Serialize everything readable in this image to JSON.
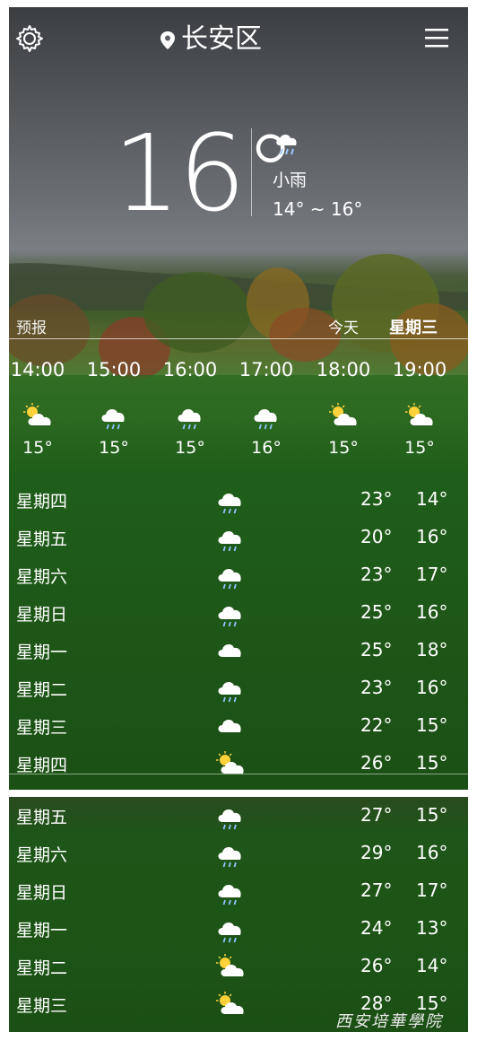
{
  "header": {
    "location": "长安区",
    "icons": [
      "settings-gear-icon",
      "location-pin-icon",
      "menu-hamburger-icon"
    ]
  },
  "current": {
    "temperature": "16°",
    "condition": "小雨",
    "range": "14° ~ 16°",
    "icon": "light-rain-icon"
  },
  "forecast": {
    "label": "预报",
    "today_label": "今天",
    "weekday_label": "星期三"
  },
  "hourly": [
    {
      "time": "14:00",
      "icon": "partly-sunny-icon",
      "temp": "15°"
    },
    {
      "time": "15:00",
      "icon": "rain-icon",
      "temp": "15°"
    },
    {
      "time": "16:00",
      "icon": "rain-icon",
      "temp": "15°"
    },
    {
      "time": "17:00",
      "icon": "rain-icon",
      "temp": "16°"
    },
    {
      "time": "18:00",
      "icon": "partly-sunny-icon",
      "temp": "15°"
    },
    {
      "time": "19:00",
      "icon": "partly-sunny-icon",
      "temp": "15°"
    }
  ],
  "daily": [
    {
      "day": "星期四",
      "icon": "rain-icon",
      "high": "23°",
      "low": "14°"
    },
    {
      "day": "星期五",
      "icon": "rain-icon",
      "high": "20°",
      "low": "16°"
    },
    {
      "day": "星期六",
      "icon": "rain-icon",
      "high": "23°",
      "low": "17°"
    },
    {
      "day": "星期日",
      "icon": "rain-icon",
      "high": "25°",
      "low": "16°"
    },
    {
      "day": "星期一",
      "icon": "cloudy-icon",
      "high": "25°",
      "low": "18°"
    },
    {
      "day": "星期二",
      "icon": "rain-icon",
      "high": "23°",
      "low": "16°"
    },
    {
      "day": "星期三",
      "icon": "cloudy-icon",
      "high": "22°",
      "low": "15°"
    },
    {
      "day": "星期四",
      "icon": "partly-sunny-icon",
      "high": "26°",
      "low": "15°"
    }
  ],
  "daily_more": [
    {
      "day": "星期五",
      "icon": "rain-icon",
      "high": "27°",
      "low": "15°"
    },
    {
      "day": "星期六",
      "icon": "rain-icon",
      "high": "29°",
      "low": "16°"
    },
    {
      "day": "星期日",
      "icon": "rain-icon",
      "high": "27°",
      "low": "17°"
    },
    {
      "day": "星期一",
      "icon": "rain-icon",
      "high": "24°",
      "low": "13°"
    },
    {
      "day": "星期二",
      "icon": "partly-sunny-icon",
      "high": "26°",
      "low": "14°"
    },
    {
      "day": "星期三",
      "icon": "partly-sunny-icon",
      "high": "28°",
      "low": "15°"
    }
  ],
  "watermark": "西安培華學院"
}
